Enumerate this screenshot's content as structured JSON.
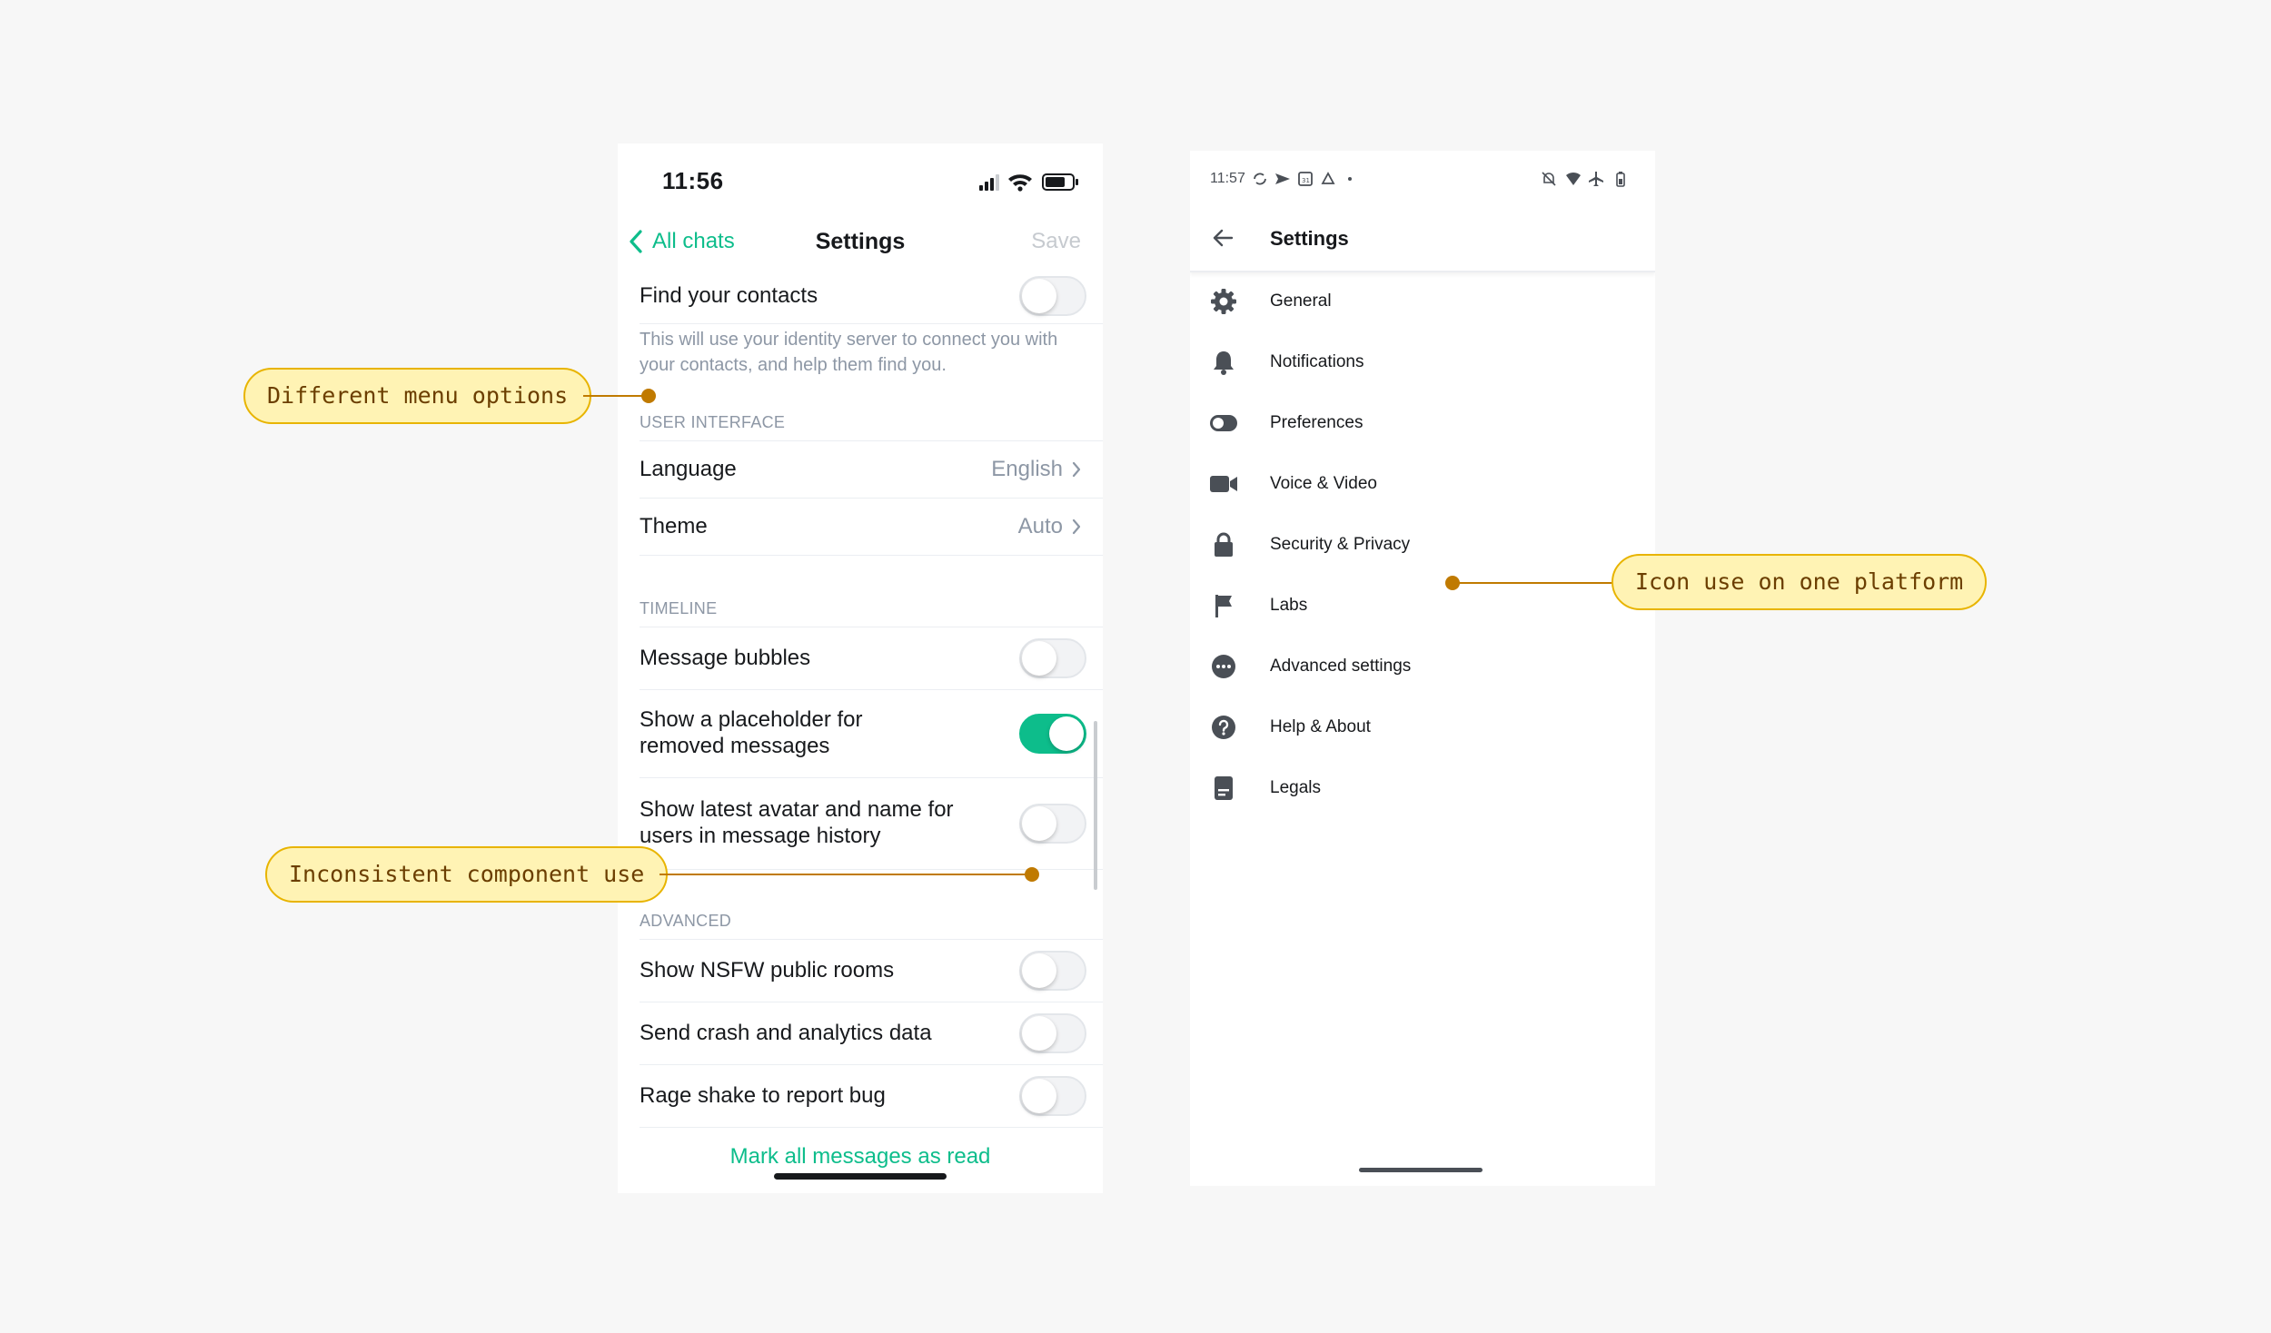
{
  "ios": {
    "status": {
      "time": "11:56"
    },
    "nav": {
      "back_label": "All chats",
      "title": "Settings",
      "save_label": "Save"
    },
    "find_contacts": {
      "label": "Find your contacts",
      "enabled": false,
      "description": "This will use your identity server to connect you with your contacts, and help them find you."
    },
    "sections": {
      "user_interface": "USER INTERFACE",
      "timeline": "TIMELINE",
      "advanced": "ADVANCED"
    },
    "user_interface": [
      {
        "label": "Language",
        "value": "English"
      },
      {
        "label": "Theme",
        "value": "Auto"
      }
    ],
    "timeline": [
      {
        "label": "Message bubbles",
        "enabled": false
      },
      {
        "label": "Show a placeholder for removed messages",
        "enabled": true
      },
      {
        "label": "Show latest avatar and name for users in message history",
        "enabled": false
      }
    ],
    "advanced": [
      {
        "label": "Show NSFW public rooms",
        "enabled": false
      },
      {
        "label": "Send crash and analytics data",
        "enabled": false
      },
      {
        "label": "Rage shake to report bug",
        "enabled": false
      }
    ],
    "mark_read_label": "Mark all messages as read"
  },
  "android": {
    "status": {
      "time": "11:57"
    },
    "toolbar": {
      "title": "Settings"
    },
    "items": [
      {
        "label": "General",
        "icon": "gear-icon"
      },
      {
        "label": "Notifications",
        "icon": "bell-icon"
      },
      {
        "label": "Preferences",
        "icon": "toggle-icon"
      },
      {
        "label": "Voice & Video",
        "icon": "video-camera-icon"
      },
      {
        "label": "Security & Privacy",
        "icon": "lock-icon"
      },
      {
        "label": "Labs",
        "icon": "flag-icon"
      },
      {
        "label": "Advanced settings",
        "icon": "more-dots-icon"
      },
      {
        "label": "Help & About",
        "icon": "help-icon"
      },
      {
        "label": "Legals",
        "icon": "document-icon"
      }
    ]
  },
  "annotations": {
    "menu_options": "Different menu options",
    "component_use": "Inconsistent component use",
    "icon_use": "Icon use on one platform"
  },
  "colors": {
    "accent": "#0dbd8b",
    "callout_fill": "#fff3b4",
    "callout_border": "#e8b400",
    "callout_line": "#c07a00"
  }
}
